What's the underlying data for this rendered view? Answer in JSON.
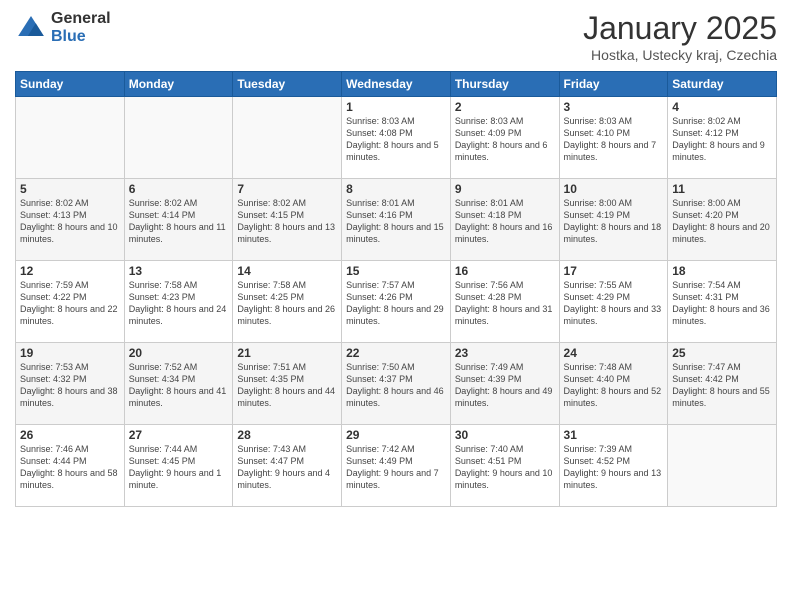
{
  "header": {
    "logo_general": "General",
    "logo_blue": "Blue",
    "month_title": "January 2025",
    "subtitle": "Hostka, Ustecky kraj, Czechia"
  },
  "weekdays": [
    "Sunday",
    "Monday",
    "Tuesday",
    "Wednesday",
    "Thursday",
    "Friday",
    "Saturday"
  ],
  "weeks": [
    [
      {
        "day": "",
        "info": ""
      },
      {
        "day": "",
        "info": ""
      },
      {
        "day": "",
        "info": ""
      },
      {
        "day": "1",
        "info": "Sunrise: 8:03 AM\nSunset: 4:08 PM\nDaylight: 8 hours and 5 minutes."
      },
      {
        "day": "2",
        "info": "Sunrise: 8:03 AM\nSunset: 4:09 PM\nDaylight: 8 hours and 6 minutes."
      },
      {
        "day": "3",
        "info": "Sunrise: 8:03 AM\nSunset: 4:10 PM\nDaylight: 8 hours and 7 minutes."
      },
      {
        "day": "4",
        "info": "Sunrise: 8:02 AM\nSunset: 4:12 PM\nDaylight: 8 hours and 9 minutes."
      }
    ],
    [
      {
        "day": "5",
        "info": "Sunrise: 8:02 AM\nSunset: 4:13 PM\nDaylight: 8 hours and 10 minutes."
      },
      {
        "day": "6",
        "info": "Sunrise: 8:02 AM\nSunset: 4:14 PM\nDaylight: 8 hours and 11 minutes."
      },
      {
        "day": "7",
        "info": "Sunrise: 8:02 AM\nSunset: 4:15 PM\nDaylight: 8 hours and 13 minutes."
      },
      {
        "day": "8",
        "info": "Sunrise: 8:01 AM\nSunset: 4:16 PM\nDaylight: 8 hours and 15 minutes."
      },
      {
        "day": "9",
        "info": "Sunrise: 8:01 AM\nSunset: 4:18 PM\nDaylight: 8 hours and 16 minutes."
      },
      {
        "day": "10",
        "info": "Sunrise: 8:00 AM\nSunset: 4:19 PM\nDaylight: 8 hours and 18 minutes."
      },
      {
        "day": "11",
        "info": "Sunrise: 8:00 AM\nSunset: 4:20 PM\nDaylight: 8 hours and 20 minutes."
      }
    ],
    [
      {
        "day": "12",
        "info": "Sunrise: 7:59 AM\nSunset: 4:22 PM\nDaylight: 8 hours and 22 minutes."
      },
      {
        "day": "13",
        "info": "Sunrise: 7:58 AM\nSunset: 4:23 PM\nDaylight: 8 hours and 24 minutes."
      },
      {
        "day": "14",
        "info": "Sunrise: 7:58 AM\nSunset: 4:25 PM\nDaylight: 8 hours and 26 minutes."
      },
      {
        "day": "15",
        "info": "Sunrise: 7:57 AM\nSunset: 4:26 PM\nDaylight: 8 hours and 29 minutes."
      },
      {
        "day": "16",
        "info": "Sunrise: 7:56 AM\nSunset: 4:28 PM\nDaylight: 8 hours and 31 minutes."
      },
      {
        "day": "17",
        "info": "Sunrise: 7:55 AM\nSunset: 4:29 PM\nDaylight: 8 hours and 33 minutes."
      },
      {
        "day": "18",
        "info": "Sunrise: 7:54 AM\nSunset: 4:31 PM\nDaylight: 8 hours and 36 minutes."
      }
    ],
    [
      {
        "day": "19",
        "info": "Sunrise: 7:53 AM\nSunset: 4:32 PM\nDaylight: 8 hours and 38 minutes."
      },
      {
        "day": "20",
        "info": "Sunrise: 7:52 AM\nSunset: 4:34 PM\nDaylight: 8 hours and 41 minutes."
      },
      {
        "day": "21",
        "info": "Sunrise: 7:51 AM\nSunset: 4:35 PM\nDaylight: 8 hours and 44 minutes."
      },
      {
        "day": "22",
        "info": "Sunrise: 7:50 AM\nSunset: 4:37 PM\nDaylight: 8 hours and 46 minutes."
      },
      {
        "day": "23",
        "info": "Sunrise: 7:49 AM\nSunset: 4:39 PM\nDaylight: 8 hours and 49 minutes."
      },
      {
        "day": "24",
        "info": "Sunrise: 7:48 AM\nSunset: 4:40 PM\nDaylight: 8 hours and 52 minutes."
      },
      {
        "day": "25",
        "info": "Sunrise: 7:47 AM\nSunset: 4:42 PM\nDaylight: 8 hours and 55 minutes."
      }
    ],
    [
      {
        "day": "26",
        "info": "Sunrise: 7:46 AM\nSunset: 4:44 PM\nDaylight: 8 hours and 58 minutes."
      },
      {
        "day": "27",
        "info": "Sunrise: 7:44 AM\nSunset: 4:45 PM\nDaylight: 9 hours and 1 minute."
      },
      {
        "day": "28",
        "info": "Sunrise: 7:43 AM\nSunset: 4:47 PM\nDaylight: 9 hours and 4 minutes."
      },
      {
        "day": "29",
        "info": "Sunrise: 7:42 AM\nSunset: 4:49 PM\nDaylight: 9 hours and 7 minutes."
      },
      {
        "day": "30",
        "info": "Sunrise: 7:40 AM\nSunset: 4:51 PM\nDaylight: 9 hours and 10 minutes."
      },
      {
        "day": "31",
        "info": "Sunrise: 7:39 AM\nSunset: 4:52 PM\nDaylight: 9 hours and 13 minutes."
      },
      {
        "day": "",
        "info": ""
      }
    ]
  ]
}
